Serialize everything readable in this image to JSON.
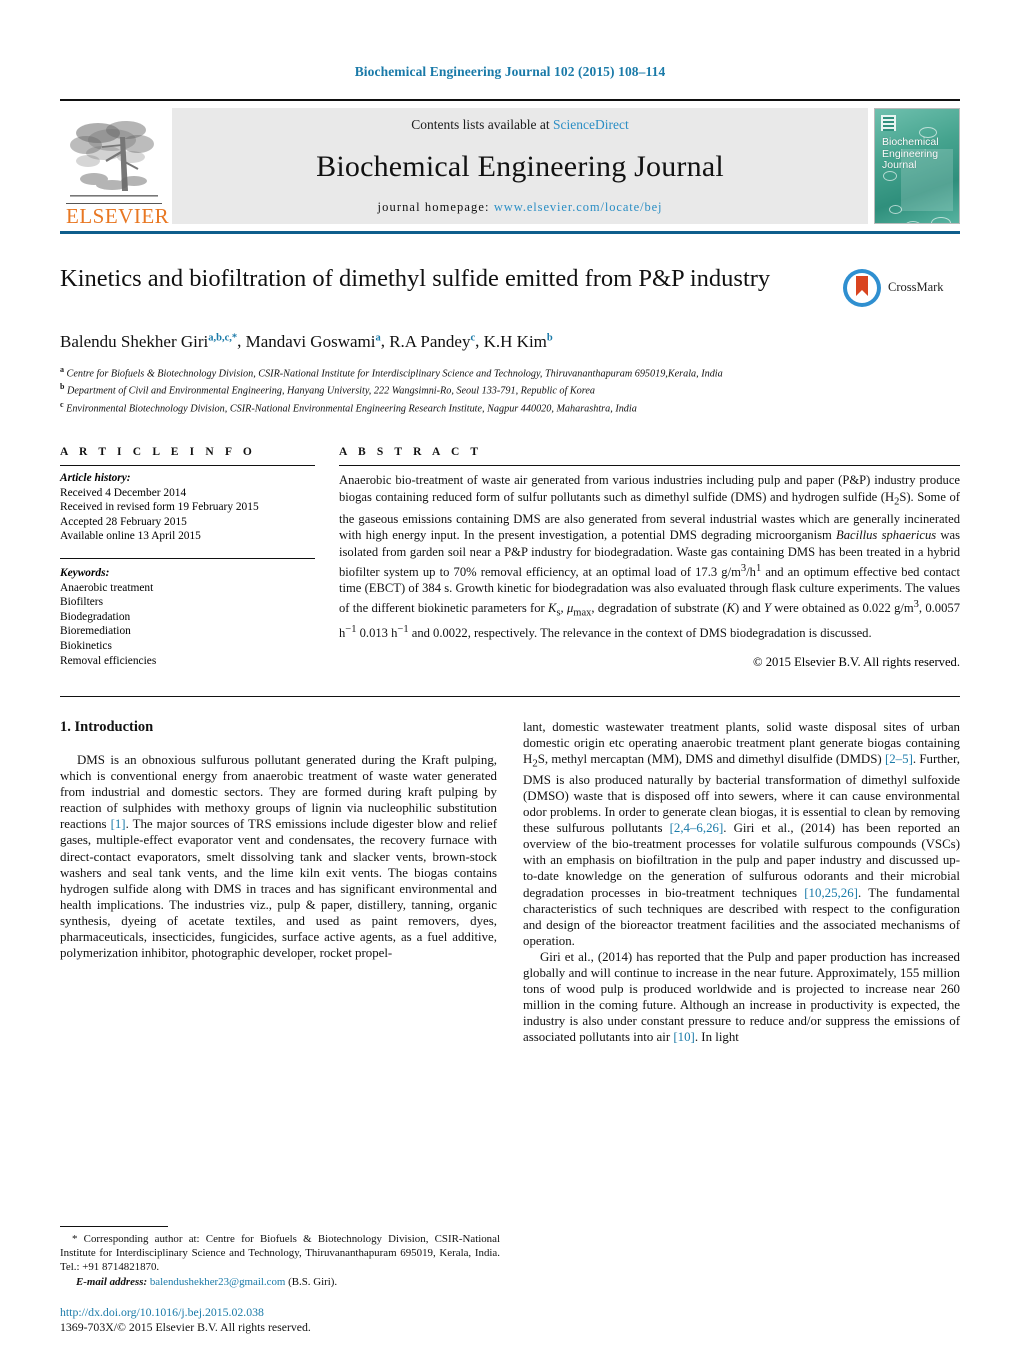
{
  "running_head": "Biochemical Engineering Journal 102 (2015) 108–114",
  "masthead": {
    "contents_prefix": "Contents lists available at ",
    "sciencedirect": "ScienceDirect",
    "journal_name": "Biochemical Engineering Journal",
    "homepage_prefix": "journal homepage:",
    "homepage_url": "www.elsevier.com/locate/bej",
    "publisher": "ELSEVIER",
    "cover_title_lines": [
      "Biochemical",
      "Engineering",
      "Journal"
    ],
    "accent_link_color": "#2b8ec4",
    "publisher_color": "#E87722",
    "cover_color": "#3f9f8b"
  },
  "article": {
    "title": "Kinetics and biofiltration of dimethyl sulfide emitted from P&P industry",
    "crossmark_label": "CrossMark",
    "authors": [
      {
        "name": "Balendu Shekher Giri",
        "marks": "a,b,c,",
        "star": "*"
      },
      {
        "name": "Mandavi Goswami",
        "marks": "a"
      },
      {
        "name": "R.A Pandey",
        "marks": "c"
      },
      {
        "name": "K.H Kim",
        "marks": "b"
      }
    ],
    "affiliations": [
      {
        "mark": "a",
        "text": "Centre for Biofuels & Biotechnology Division, CSIR-National Institute for Interdisciplinary Science and Technology, Thiruvananthapuram 695019,Kerala, India"
      },
      {
        "mark": "b",
        "text": "Department of Civil and Environmental Engineering, Hanyang University, 222 Wangsimni-Ro, Seoul 133-791, Republic of Korea"
      },
      {
        "mark": "c",
        "text": "Environmental Biotechnology Division, CSIR-National Environmental Engineering Research Institute, Nagpur 440020, Maharashtra, India"
      }
    ]
  },
  "article_info": {
    "heading": "A R T I C L E   I N F O",
    "history_label": "Article history:",
    "history": [
      "Received 4 December 2014",
      "Received in revised form 19 February 2015",
      "Accepted 28 February 2015",
      "Available online 13 April 2015"
    ],
    "keywords_label": "Keywords:",
    "keywords": [
      "Anaerobic treatment",
      "Biofilters",
      "Biodegradation",
      "Bioremediation",
      "Biokinetics",
      "Removal efficiencies"
    ]
  },
  "abstract": {
    "heading": "A B S T R A C T",
    "p1": "Anaerobic bio-treatment of waste air generated from various industries including pulp and paper (P&P) industry produce biogas containing reduced form of sulfur pollutants such as dimethyl sulfide (DMS) and hydrogen sulfide (H",
    "p1b": "S). Some of the gaseous emissions containing DMS are also generated from several industrial wastes which are generally incinerated with high energy input. In the present investigation, a potential DMS degrading microorganism ",
    "organism": "Bacillus sphaericus",
    "p1c": " was isolated from garden soil near a P&P industry for biodegradation. Waste gas containing DMS has been treated in a hybrid biofilter system up to 70% removal efficiency, at an optimal load of 17.3 g/m",
    "load_sup": "3",
    "p1d": "/h",
    "load_sup2": "1",
    "p1e": " and an optimum effective bed contact time (EBCT) of 384 s. Growth kinetic for biodegradation was also evaluated through flask culture experiments. The values of the different biokinetic parameters for ",
    "ks": "K",
    "ks_sub": "s",
    "mu": "μ",
    "mu_sub": "max",
    "p1f": ", degradation of substrate (",
    "k_sym": "K",
    "p1g": ") and ",
    "y_sym": "Y",
    "p1h": " were obtained as 0.022 g/m",
    "val_sup": "3",
    "p1i": ", 0.0057 h",
    "val_sup2": "−1",
    "p1j": " 0.013 h",
    "val_sup3": "−1",
    "p1k": " and 0.0022, respectively. The relevance in the context of DMS biodegradation is discussed.",
    "copyright": "© 2015 Elsevier B.V. All rights reserved."
  },
  "intro": {
    "heading": "1.  Introduction",
    "left_p1_a": "DMS is an obnoxious sulfurous pollutant generated during the Kraft pulping, which is conventional energy from anaerobic treatment of waste water generated from industrial and domestic sectors. They are formed during kraft pulping by reaction of sulphides with methoxy groups of lignin via nucleophilic substitution reactions ",
    "ref1": "[1]",
    "left_p1_b": ". The major sources of TRS emissions include digester blow and relief gases, multiple-effect evaporator vent and condensates, the recovery furnace with direct-contact evaporators, smelt dissolving tank and slacker vents, brown-stock washers and seal tank vents, and the lime kiln exit vents. The biogas contains hydrogen sulfide along with DMS in traces and has significant environmental and health implications. The industries viz., pulp & paper, distillery, tanning, organic synthesis, dyeing of acetate textiles, and used as paint removers, dyes, pharmaceuticals, insecticides, fungicides, surface active agents, as a fuel additive, polymerization inhibitor, photographic developer, rocket propel-",
    "right_p1_a": "lant, domestic wastewater treatment plants, solid waste disposal sites of urban domestic origin etc operating anaerobic treatment plant generate biogas containing H",
    "h2s_sub": "2",
    "right_p1_b": "S, methyl mercaptan (MM), DMS and dimethyl disulfide (DMDS) ",
    "ref2": "[2–5]",
    "right_p1_c": ". Further, DMS is also produced naturally by bacterial transformation of dimethyl sulfoxide (DMSO) waste that is disposed off into sewers, where it can cause environmental odor problems. In order to generate clean biogas, it is essential to clean by removing these sulfurous pollutants ",
    "ref3": "[2,4–6,26]",
    "right_p1_d": ". Giri et al., (2014) has been reported an overview of the bio-treatment processes for volatile sulfurous compounds (VSCs) with an emphasis on biofiltration in the pulp and paper industry and discussed up-to-date knowledge on the generation of sulfurous odorants and their microbial degradation processes in bio-treatment techniques ",
    "ref4": "[10,25,26]",
    "right_p1_e": ". The fundamental characteristics of such techniques are described with respect to the configuration and design of the bioreactor treatment facilities and the associated mechanisms of operation.",
    "right_p2_a": "Giri et al., (2014) has reported that the Pulp and paper production has increased globally and will continue to increase in the near future. Approximately, 155 million tons of wood pulp is produced worldwide and is projected to increase near 260 million in the coming future. Although an increase in productivity is expected, the industry is also under constant pressure to reduce and/or suppress the emissions of associated pollutants into air ",
    "ref5": "[10]",
    "right_p2_b": ". In light"
  },
  "footnote": {
    "star": "*",
    "text": " Corresponding author at: Centre for Biofuels & Biotechnology Division, CSIR-National Institute for Interdisciplinary Science and Technology, Thiruvananthapuram 695019, Kerala, India. Tel.: +91 8714821870.",
    "email_label": "E-mail address:",
    "email": "balendushekher23@gmail.com",
    "email_owner": " (B.S. Giri)."
  },
  "bottom": {
    "doi": "http://dx.doi.org/10.1016/j.bej.2015.02.038",
    "issn": "1369-703X/© 2015 Elsevier B.V. All rights reserved."
  }
}
